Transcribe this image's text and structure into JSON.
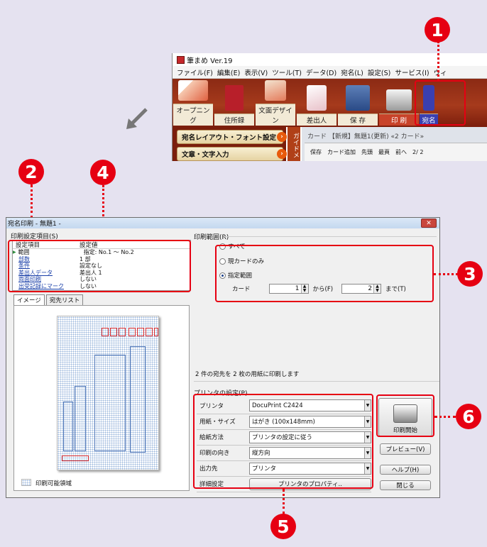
{
  "app": {
    "title": "筆まめ Ver.19",
    "menu": [
      "ファイル(F)",
      "編集(E)",
      "表示(V)",
      "ツール(T)",
      "データ(D)",
      "宛名(L)",
      "設定(S)",
      "サービス(I)",
      "ウィ"
    ],
    "toolbar": [
      "オープニング",
      "住所録",
      "文面デザイン",
      "差出人",
      "保 存",
      "印 刷",
      "宛名"
    ],
    "side_buttons": [
      "宛名レイアウト・フォント設定",
      "文章・文字入力"
    ],
    "guide_label": "ガイドメ",
    "card_tab": "カード 【新規】無題1(更新) «2 カード»",
    "card_tools": [
      "保存",
      "カード追加",
      "先頭",
      "最頁",
      "前へ"
    ],
    "card_pager": "2/ 2"
  },
  "callouts": [
    "1",
    "2",
    "3",
    "4",
    "5",
    "6"
  ],
  "dialog": {
    "title": "宛名印刷 - 無題1 -",
    "settings_group": "印刷設定項目(S)",
    "col_item": "設定項目",
    "col_value": "設定値",
    "rows": [
      {
        "item": "範囲",
        "value": "指定: No.1 〜 No.2"
      },
      {
        "item": "部数",
        "value": "1 部"
      },
      {
        "item": "条件",
        "value": "設定なし"
      },
      {
        "item": "差出人データ",
        "value": "差出人 1"
      },
      {
        "item": "両面印刷",
        "value": "しない"
      },
      {
        "item": "出受記録にマーク",
        "value": "しない"
      }
    ],
    "tabs": [
      "イメージ",
      "宛先リスト"
    ],
    "printable_area": "印刷可能領域",
    "range_group": "印刷範囲(R)",
    "range_options": [
      "すべて",
      "現カードのみ",
      "指定範囲"
    ],
    "card_label": "カード",
    "from_value": "1",
    "from_label": "から(F)",
    "to_value": "2",
    "to_label": "まで(T)",
    "summary": "2 件の宛先を 2 枚の用紙に印刷します",
    "printer_group": "プリンタの設定(P)",
    "printer_rows": [
      {
        "label": "プリンタ",
        "value": "DocuPrint C2424"
      },
      {
        "label": "用紙・サイズ",
        "value": "はがき (100x148mm)"
      },
      {
        "label": "給紙方法",
        "value": "プリンタの設定に従う"
      },
      {
        "label": "印刷の向き",
        "value": "縦方向"
      },
      {
        "label": "出力先",
        "value": "プリンタ"
      }
    ],
    "detail_label": "詳細設定",
    "properties_button": "プリンタのプロパティ..",
    "print_start": "印刷開始",
    "preview_button": "プレビュー(V)",
    "help_button": "ヘルプ(H)",
    "close_button": "閉じる"
  },
  "colors": {
    "callout": "#e60012",
    "toolbar": "#8b2a14",
    "title_bar": "#c4d8ef"
  }
}
